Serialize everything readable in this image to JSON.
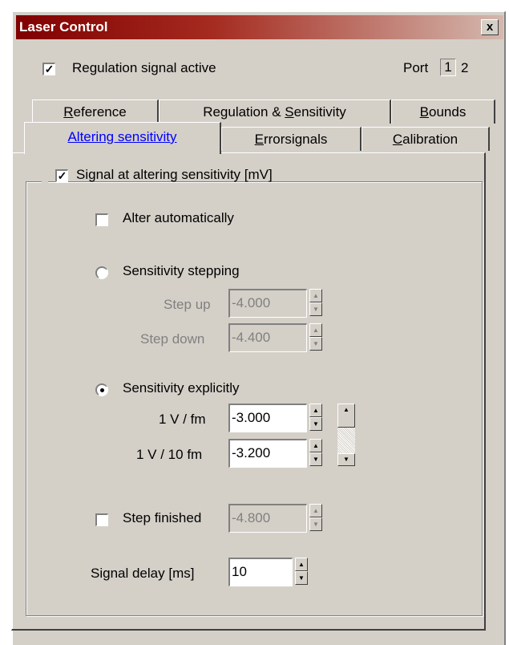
{
  "window": {
    "title": "Laser Control",
    "close_glyph": "x"
  },
  "regulation": {
    "label": "Regulation signal active",
    "checked": true,
    "check_glyph": "✓"
  },
  "port": {
    "label": "Port",
    "selected": "1",
    "other": "2"
  },
  "tabs_back": [
    {
      "label": "Reference",
      "ul": "R",
      "rest": "eference"
    },
    {
      "label": "Regulation & Sensitivity",
      "pre": "Regulation & ",
      "ul": "S",
      "rest": "ensitivity"
    },
    {
      "label": "Bounds",
      "ul": "B",
      "rest": "ounds"
    }
  ],
  "tabs_front": [
    {
      "label": "Altering sensitivity",
      "active": true
    },
    {
      "label": "Errorsignals",
      "ul": "E",
      "rest": "rrorsignals"
    },
    {
      "label": "Calibration",
      "ul": "C",
      "rest": "alibration"
    }
  ],
  "group": {
    "label": "Signal at altering sensitivity  [mV]",
    "checked": true,
    "check_glyph": "✓"
  },
  "alter_auto": {
    "label": "Alter automatically",
    "checked": false
  },
  "stepping": {
    "label": "Sensitivity stepping",
    "selected": false,
    "step_up_label": "Step up",
    "step_up_value": "-4.000",
    "step_down_label": "Step down",
    "step_down_value": "-4.400"
  },
  "explicit": {
    "label": "Sensitivity explicitly",
    "selected": true,
    "fm1_label": "1 V / fm",
    "fm1_value": "-3.000",
    "fm10_label": "1 V / 10 fm",
    "fm10_value": "-3.200"
  },
  "step_finished": {
    "label": "Step finished",
    "checked": false,
    "value": "-4.800"
  },
  "signal_delay": {
    "label": "Signal delay  [ms]",
    "value": "10"
  },
  "spin_glyphs": {
    "up": "▲",
    "down": "▼"
  }
}
